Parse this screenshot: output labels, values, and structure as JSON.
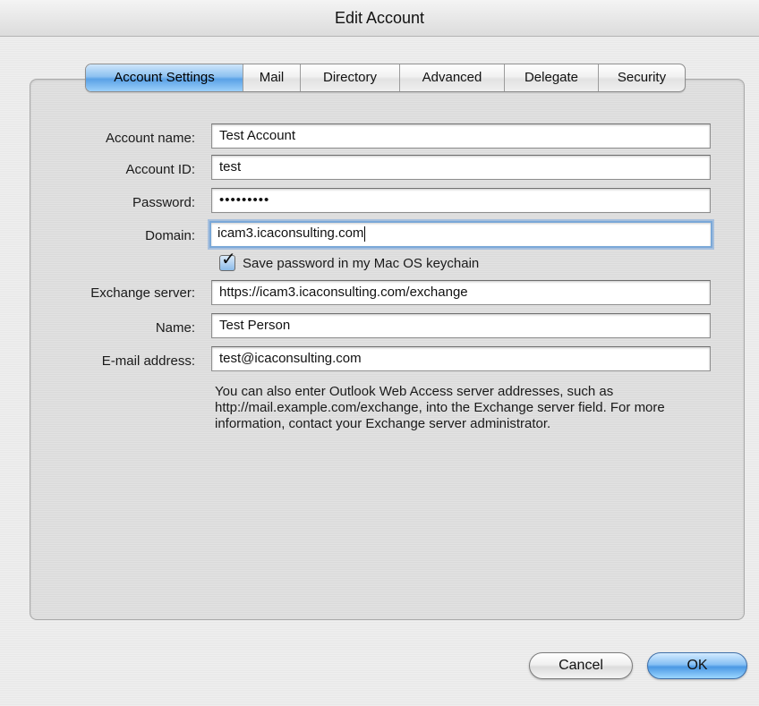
{
  "window": {
    "title": "Edit Account"
  },
  "tabs": [
    {
      "label": "Account Settings",
      "active": true
    },
    {
      "label": "Mail",
      "active": false
    },
    {
      "label": "Directory",
      "active": false
    },
    {
      "label": "Advanced",
      "active": false
    },
    {
      "label": "Delegate",
      "active": false
    },
    {
      "label": "Security",
      "active": false
    }
  ],
  "form": {
    "account_name": {
      "label": "Account name:",
      "value": "Test Account"
    },
    "account_id": {
      "label": "Account ID:",
      "value": "test"
    },
    "password": {
      "label": "Password:",
      "value": "•••••••••"
    },
    "domain": {
      "label": "Domain:",
      "value": "icam3.icaconsulting.com"
    },
    "save_password": {
      "label": "Save password in my Mac OS keychain",
      "checked": true
    },
    "exchange_server": {
      "label": "Exchange server:",
      "value": "https://icam3.icaconsulting.com/exchange"
    },
    "name": {
      "label": "Name:",
      "value": "Test Person"
    },
    "email": {
      "label": "E-mail address:",
      "value": "test@icaconsulting.com"
    }
  },
  "help_text": "You can also enter Outlook Web Access server addresses, such as http://mail.example.com/exchange, into the Exchange server field. For more information, contact your Exchange server administrator.",
  "buttons": {
    "cancel": "Cancel",
    "ok": "OK"
  },
  "colors": {
    "accent_blue": "#5aa1e6",
    "focus_ring": "#7aa8d8"
  }
}
